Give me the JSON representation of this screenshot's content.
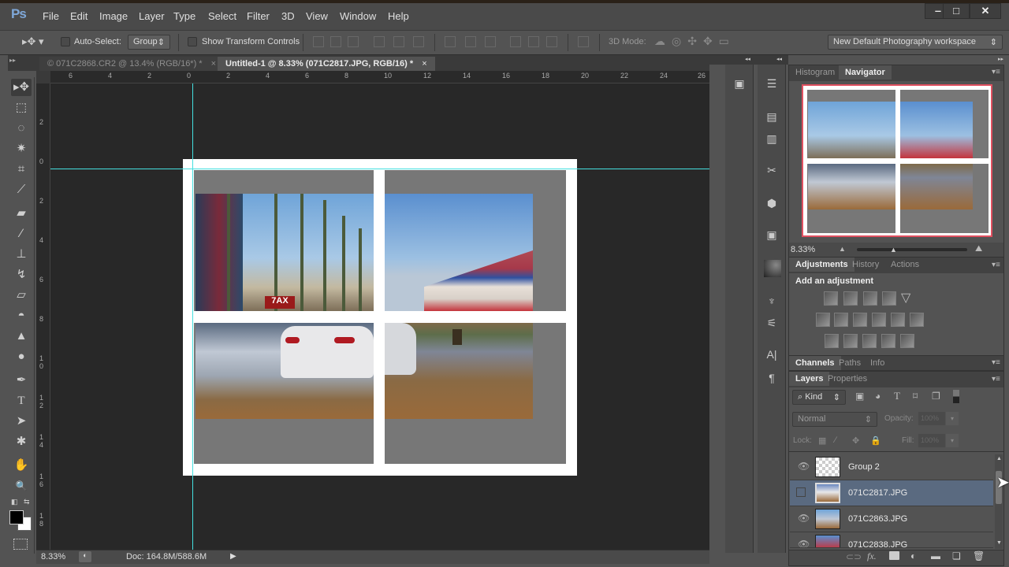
{
  "app": {
    "logo": "Ps",
    "menu": [
      "File",
      "Edit",
      "Image",
      "Layer",
      "Type",
      "Select",
      "Filter",
      "3D",
      "View",
      "Window",
      "Help"
    ],
    "window_controls": {
      "minimize": "‒",
      "maximize": "□",
      "close": "✕"
    }
  },
  "options_bar": {
    "auto_select_label": "Auto-Select:",
    "auto_select_checked": false,
    "auto_select_target": "Group",
    "show_transform_label": "Show Transform Controls",
    "show_transform_checked": false,
    "mode_3d_label": "3D Mode:",
    "workspace": "New Default Photography workspace"
  },
  "tabs": [
    {
      "label": "© 071C2868.CR2 @ 13.4% (RGB/16*) *",
      "close": "×",
      "active": false
    },
    {
      "label": "Untitled-1 @ 8.33% (071C2817.JPG, RGB/16) *",
      "close": "×",
      "active": true
    }
  ],
  "rulers": {
    "horizontal": [
      "6",
      "4",
      "2",
      "0",
      "2",
      "4",
      "6",
      "8",
      "10",
      "12",
      "14",
      "16",
      "18",
      "20",
      "22",
      "24",
      "26"
    ],
    "vertical": [
      "2",
      "0",
      "2",
      "4",
      "6",
      "8",
      "10",
      "12",
      "14",
      "16",
      "18"
    ]
  },
  "tools": [
    {
      "name": "move-tool",
      "glyph": "▸✥"
    },
    {
      "name": "marquee-tool",
      "glyph": "⬚"
    },
    {
      "name": "lasso-tool",
      "glyph": "◌"
    },
    {
      "name": "magic-wand-tool",
      "glyph": "✷"
    },
    {
      "name": "crop-tool",
      "glyph": "⌗"
    },
    {
      "name": "eyedropper-tool",
      "glyph": "⟋"
    },
    {
      "name": "healing-brush-tool",
      "glyph": "▰"
    },
    {
      "name": "brush-tool",
      "glyph": "∕"
    },
    {
      "name": "clone-stamp-tool",
      "glyph": "⊥"
    },
    {
      "name": "history-brush-tool",
      "glyph": "↯"
    },
    {
      "name": "eraser-tool",
      "glyph": "▱"
    },
    {
      "name": "paint-bucket-tool",
      "glyph": "◓"
    },
    {
      "name": "blur-tool",
      "glyph": "▲"
    },
    {
      "name": "dodge-tool",
      "glyph": "●"
    },
    {
      "name": "pen-tool",
      "glyph": "✒"
    },
    {
      "name": "type-tool",
      "glyph": "T"
    },
    {
      "name": "path-selection-tool",
      "glyph": "➤"
    },
    {
      "name": "custom-shape-tool",
      "glyph": "✱"
    },
    {
      "name": "hand-tool",
      "glyph": "✋"
    },
    {
      "name": "zoom-tool",
      "glyph": "🔍"
    }
  ],
  "colors": {
    "foreground": "#000000",
    "background": "#ffffff",
    "guide": "#44e0e0",
    "navigator_frame": "#e05060",
    "selected_layer": "#5a6a80"
  },
  "status_bar": {
    "zoom": "8.33%",
    "doc_info": "Doc: 164.8M/588.6M",
    "arrow": "▶"
  },
  "navigator": {
    "tabs": [
      "Histogram",
      "Navigator"
    ],
    "active_tab": "Navigator",
    "zoom": "8.33%",
    "zoom_slider_value": 0.5
  },
  "adjustments": {
    "tabs": [
      "Adjustments",
      "History",
      "Actions"
    ],
    "active_tab": "Adjustments",
    "heading": "Add an adjustment",
    "rows": [
      [
        "brightness-contrast",
        "levels",
        "curves",
        "exposure",
        "vibrance"
      ],
      [
        "hue-saturation",
        "color-balance",
        "black-white",
        "photo-filter",
        "channel-mixer",
        "color-lookup"
      ],
      [
        "invert",
        "posterize",
        "threshold",
        "selective-color",
        "gradient-map"
      ]
    ]
  },
  "channels": {
    "tabs": [
      "Channels",
      "Paths",
      "Info"
    ],
    "active_tab": "Channels"
  },
  "layers": {
    "tabs": [
      "Layers",
      "Properties"
    ],
    "active_tab": "Layers",
    "filter_kind": "Kind",
    "blend_mode": "Normal",
    "opacity_label": "Opacity:",
    "opacity": "100%",
    "lock_label": "Lock:",
    "fill_label": "Fill:",
    "fill": "100%",
    "items": [
      {
        "name": "Group 2",
        "visible": true,
        "selected": false,
        "thumb": "transparent"
      },
      {
        "name": "071C2817.JPG",
        "visible": false,
        "selected": true,
        "thumb": "photo"
      },
      {
        "name": "071C2863.JPG",
        "visible": true,
        "selected": false,
        "thumb": "photo"
      },
      {
        "name": "071C2838.JPG",
        "visible": true,
        "selected": false,
        "thumb": "photo"
      }
    ],
    "footer_icons": [
      "link-icon",
      "fx-icon",
      "mask-icon",
      "adjustment-layer-icon",
      "group-folder-icon",
      "new-layer-icon",
      "trash-icon"
    ]
  }
}
